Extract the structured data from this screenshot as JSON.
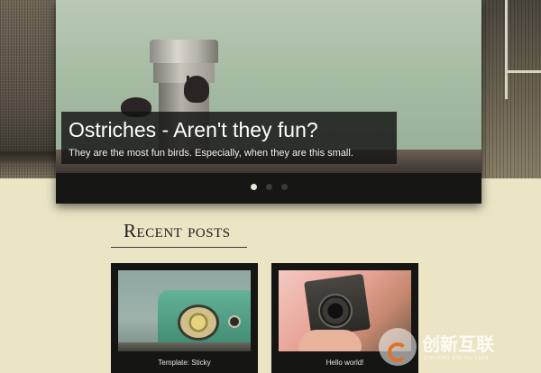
{
  "slider": {
    "title": "Ostriches - Aren't they fun?",
    "text": "They are the most fun birds. Especially, when they are this small.",
    "dots": [
      {
        "active": true
      },
      {
        "active": false
      },
      {
        "active": false
      }
    ]
  },
  "recent": {
    "heading": "Recent posts",
    "posts": [
      {
        "label": "Template: Sticky",
        "image": "vintage-radio-image"
      },
      {
        "label": "Hello world!",
        "image": "vintage-camera-image"
      }
    ]
  },
  "watermark": {
    "main": "创新互联",
    "sub": "CHUANG XIN HU LIAN"
  }
}
